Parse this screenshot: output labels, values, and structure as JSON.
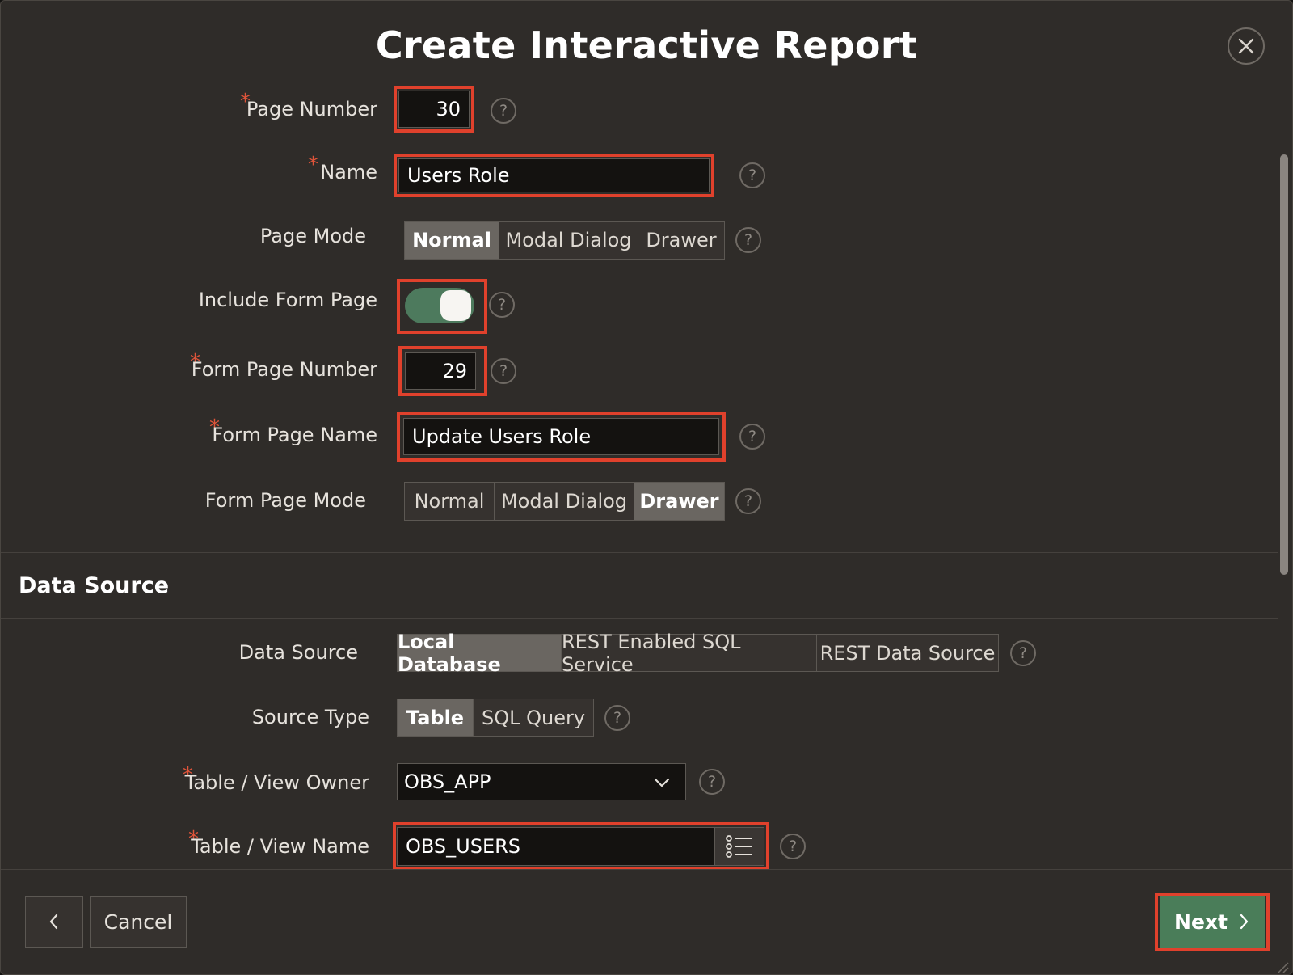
{
  "dialog": {
    "title": "Create Interactive Report",
    "close_icon": "close-icon"
  },
  "page_attributes": {
    "page_number": {
      "label": "Page Number",
      "value": "30",
      "required": true
    },
    "name": {
      "label": "Name",
      "value": "Users Role",
      "required": true
    },
    "page_mode": {
      "label": "Page Mode",
      "options": [
        "Normal",
        "Modal Dialog",
        "Drawer"
      ],
      "selected": "Normal"
    },
    "include_form_page": {
      "label": "Include Form Page",
      "on": true
    },
    "form_page_number": {
      "label": "Form Page Number",
      "value": "29",
      "required": true
    },
    "form_page_name": {
      "label": "Form Page Name",
      "value": "Update Users Role",
      "required": true
    },
    "form_page_mode": {
      "label": "Form Page Mode",
      "options": [
        "Normal",
        "Modal Dialog",
        "Drawer"
      ],
      "selected": "Drawer"
    }
  },
  "data_source_section": {
    "title": "Data Source",
    "data_source": {
      "label": "Data Source",
      "options": [
        "Local Database",
        "REST Enabled SQL Service",
        "REST Data Source"
      ],
      "selected": "Local Database"
    },
    "source_type": {
      "label": "Source Type",
      "options": [
        "Table",
        "SQL Query"
      ],
      "selected": "Table"
    },
    "table_view_owner": {
      "label": "Table / View Owner",
      "value": "OBS_APP",
      "required": true
    },
    "table_view_name": {
      "label": "Table / View Name",
      "value": "OBS_USERS",
      "required": true
    }
  },
  "help_glyph": "?",
  "required_marker": "*",
  "footer": {
    "back_icon": "chevron-left-icon",
    "cancel_label": "Cancel",
    "next_label": "Next"
  },
  "colors": {
    "dialog_bg": "#2f2c29",
    "highlight": "#e0412c",
    "primary_button": "#4a7d59",
    "toggle_on": "#4d7a5d",
    "required": "#e0543a"
  }
}
